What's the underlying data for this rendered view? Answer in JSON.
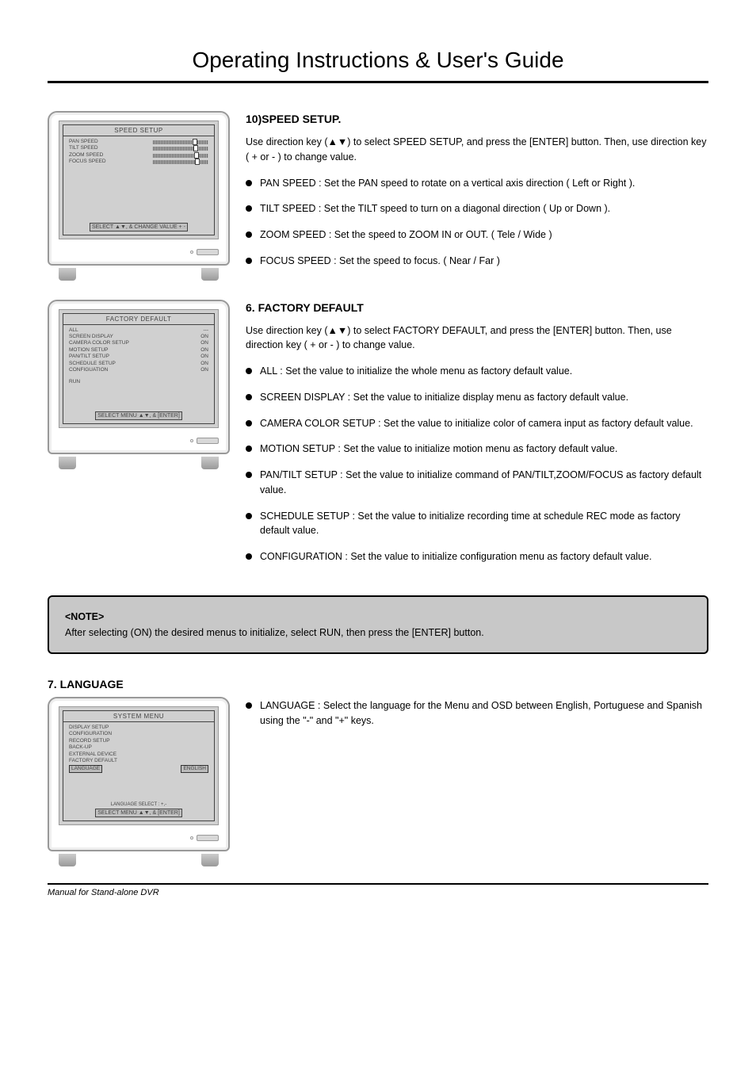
{
  "page_title": "Operating Instructions & User's Guide",
  "footer_text": "Manual for Stand-alone DVR",
  "sections": {
    "speed_setup": {
      "heading": "10)SPEED SETUP.",
      "instr": "Use direction key (▲▼) to select SPEED SETUP, and press the [ENTER] button. Then, use direction key ( + or - ) to change value.",
      "bullets": [
        "PAN SPEED : Set the PAN speed to rotate on a vertical axis direction ( Left or Right ).",
        "TILT SPEED : Set the TILT speed to turn on a diagonal direction ( Up or Down ).",
        "ZOOM SPEED : Set the speed to ZOOM IN or OUT. ( Tele / Wide )",
        "FOCUS SPEED : Set the speed to focus. ( Near / Far )"
      ],
      "screen": {
        "title": "SPEED SETUP",
        "items": [
          "PAN SPEED",
          "TILT SPEED",
          "ZOOM SPEED",
          "FOCUS SPEED"
        ],
        "footer": "SELECT ▲▼, & CHANGE VALUE + -"
      }
    },
    "factory_default": {
      "heading": "6. FACTORY DEFAULT",
      "instr": "Use direction key (▲▼) to select FACTORY DEFAULT, and press the [ENTER] button. Then, use direction key ( + or - ) to change value.",
      "bullets": [
        "ALL : Set the value to initialize the whole menu as factory default value.",
        "SCREEN DISPLAY : Set the value to initialize display menu as factory default value.",
        "CAMERA COLOR SETUP : Set the value to initialize color of camera input as factory default value.",
        "MOTION SETUP : Set the value to initialize motion menu as factory default value.",
        "PAN/TILT SETUP : Set the value to initialize command of PAN/TILT,ZOOM/FOCUS as factory default value.",
        "SCHEDULE SETUP : Set the value to initialize recording time at schedule REC mode as factory default value.",
        "CONFIGURATION : Set the value to initialize configuration menu as factory default value."
      ],
      "screen": {
        "title": "FACTORY DEFAULT",
        "items": [
          {
            "label": "ALL",
            "val": "---"
          },
          {
            "label": "SCREEN DISPLAY",
            "val": "ON"
          },
          {
            "label": "CAMERA COLOR SETUP",
            "val": "ON"
          },
          {
            "label": "MOTION SETUP",
            "val": "ON"
          },
          {
            "label": "PAN/TILT SETUP",
            "val": "ON"
          },
          {
            "label": "SCHEDULE SETUP",
            "val": "ON"
          },
          {
            "label": "CONFIGUATION",
            "val": "ON"
          }
        ],
        "run": "RUN",
        "footer": "SELECT MENU ▲▼, & [ENTER]"
      }
    },
    "language": {
      "heading": "7. LANGUAGE",
      "bullets": [
        "LANGUAGE : Select the language for the Menu and OSD between English, Portuguese and Spanish using the \"-\" and \"+\" keys."
      ],
      "screen": {
        "title": "SYSTEM MENU",
        "items": [
          "DISPLAY SETUP",
          "CONFIGURATION",
          "RECORD SETUP",
          "BACK-UP",
          "EXTERNAL DEVICE",
          "FACTORY DEFAULT"
        ],
        "selected_label": "LANGUAGE",
        "selected_value": "ENGLISH",
        "footer1": "LANGUAGE SELECT : +,-",
        "footer2": "SELECT MENU ▲▼, & [ENTER]"
      }
    }
  },
  "note": {
    "heading": "<NOTE>",
    "body": "After selecting (ON) the desired menus to initialize, select RUN, then press the [ENTER] button."
  }
}
